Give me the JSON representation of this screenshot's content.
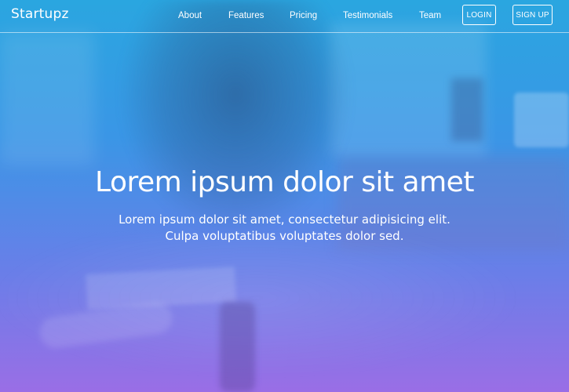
{
  "brand": "Startupz",
  "nav": {
    "links": [
      {
        "label": "About"
      },
      {
        "label": "Features"
      },
      {
        "label": "Pricing"
      },
      {
        "label": "Testimonials"
      },
      {
        "label": "Team"
      }
    ],
    "login_label": "LOGIN",
    "signup_label": "SIGN UP"
  },
  "hero": {
    "title": "Lorem ipsum dolor sit amet",
    "subtitle": "Lorem ipsum dolor sit amet, consectetur adipisicing elit. Culpa voluptatibus voluptates dolor sed."
  },
  "colors": {
    "gradient_top": "#2aa6e0",
    "gradient_bottom": "#9a6ee6",
    "text": "#ffffff"
  }
}
